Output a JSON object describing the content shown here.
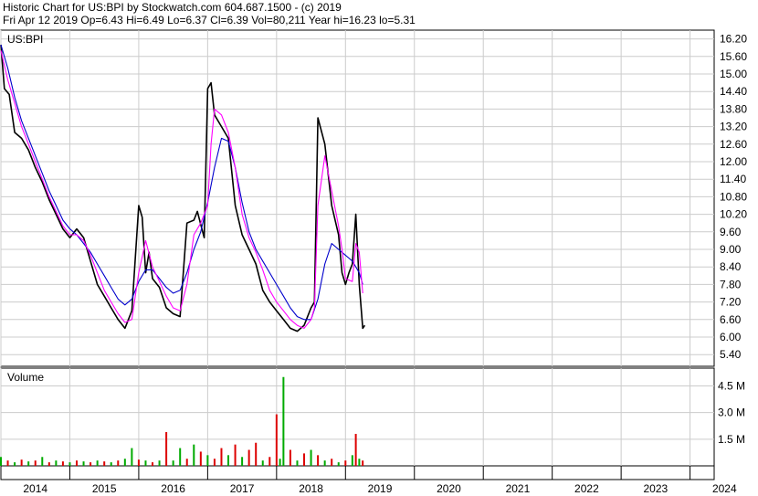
{
  "header": {
    "line1": "Historic Chart for US:BPI by Stockwatch.com 604.687.1500 - (c) 2019",
    "line2": "Fri Apr 12 2019  Op=6.43  Hi=6.49  Lo=6.37  Cl=6.39  Vol=80,211  Year hi=16.23  lo=5.31"
  },
  "colors": {
    "price": "#000000",
    "ma_short": "#ff00ff",
    "ma_long": "#0000cc",
    "vol_up": "#00aa00",
    "vol_down": "#dd0000",
    "grid": "#cccccc"
  },
  "chart_data": {
    "type": "line",
    "symbol_label": "US:BPI",
    "volume_label": "Volume",
    "price_axis": {
      "ylim": [
        5.0,
        16.5
      ],
      "ticks": [
        "16.20",
        "15.60",
        "15.00",
        "14.40",
        "13.80",
        "13.20",
        "12.60",
        "12.00",
        "11.40",
        "10.80",
        "10.20",
        "9.60",
        "9.00",
        "8.40",
        "7.80",
        "7.20",
        "6.60",
        "6.00",
        "5.40"
      ]
    },
    "volume_axis": {
      "ylim": [
        0,
        5500000
      ],
      "ticks": [
        {
          "label": "4.5 M",
          "value": 4500000
        },
        {
          "label": "3.0 M",
          "value": 3000000
        },
        {
          "label": "1.5 M",
          "value": 1500000
        }
      ]
    },
    "x_axis": {
      "xlim": [
        2014.0,
        2024.35
      ],
      "year_labels": [
        "2014",
        "2015",
        "2016",
        "2017",
        "2018",
        "2019",
        "2020",
        "2021",
        "2022",
        "2023",
        "2024"
      ]
    },
    "series": [
      {
        "role": "price",
        "x": [
          2014.0,
          2014.05,
          2014.12,
          2014.2,
          2014.3,
          2014.4,
          2014.5,
          2014.6,
          2014.7,
          2014.8,
          2014.9,
          2015.0,
          2015.1,
          2015.2,
          2015.3,
          2015.4,
          2015.5,
          2015.6,
          2015.7,
          2015.8,
          2015.9,
          2016.0,
          2016.05,
          2016.1,
          2016.15,
          2016.2,
          2016.3,
          2016.4,
          2016.5,
          2016.6,
          2016.7,
          2016.8,
          2016.85,
          2016.95,
          2017.0,
          2017.05,
          2017.1,
          2017.2,
          2017.3,
          2017.4,
          2017.5,
          2017.6,
          2017.7,
          2017.8,
          2017.9,
          2018.0,
          2018.1,
          2018.2,
          2018.3,
          2018.4,
          2018.5,
          2018.55,
          2018.6,
          2018.7,
          2018.8,
          2018.9,
          2018.95,
          2019.0,
          2019.05,
          2019.1,
          2019.15,
          2019.2,
          2019.25,
          2019.28
        ],
        "y": [
          16.0,
          14.5,
          14.3,
          13.0,
          12.8,
          12.4,
          11.8,
          11.3,
          10.7,
          10.2,
          9.7,
          9.4,
          9.7,
          9.4,
          8.6,
          7.8,
          7.4,
          7.0,
          6.6,
          6.3,
          6.9,
          10.5,
          10.1,
          8.2,
          8.9,
          8.0,
          7.7,
          7.0,
          6.8,
          6.7,
          9.9,
          10.0,
          10.3,
          9.4,
          14.5,
          14.7,
          13.6,
          13.2,
          12.8,
          10.5,
          9.5,
          9.0,
          8.5,
          7.6,
          7.2,
          6.9,
          6.6,
          6.3,
          6.2,
          6.4,
          7.0,
          7.2,
          13.5,
          12.6,
          10.5,
          9.5,
          8.2,
          7.8,
          8.2,
          8.5,
          10.2,
          7.8,
          6.3,
          6.4
        ]
      },
      {
        "role": "ma_short",
        "x": [
          2014.0,
          2014.1,
          2014.2,
          2014.3,
          2014.4,
          2014.5,
          2014.6,
          2014.7,
          2014.8,
          2014.9,
          2015.0,
          2015.1,
          2015.2,
          2015.3,
          2015.4,
          2015.5,
          2015.6,
          2015.7,
          2015.8,
          2015.9,
          2016.0,
          2016.1,
          2016.2,
          2016.3,
          2016.4,
          2016.5,
          2016.6,
          2016.7,
          2016.8,
          2016.9,
          2017.0,
          2017.05,
          2017.1,
          2017.2,
          2017.3,
          2017.4,
          2017.5,
          2017.6,
          2017.7,
          2017.8,
          2017.9,
          2018.0,
          2018.1,
          2018.2,
          2018.3,
          2018.4,
          2018.5,
          2018.55,
          2018.6,
          2018.7,
          2018.8,
          2018.9,
          2018.95,
          2019.0,
          2019.1,
          2019.15,
          2019.2,
          2019.25
        ],
        "y": [
          15.8,
          14.8,
          14.0,
          13.2,
          12.6,
          12.0,
          11.4,
          10.8,
          10.3,
          9.8,
          9.5,
          9.5,
          9.3,
          8.8,
          8.2,
          7.6,
          7.2,
          6.8,
          6.5,
          6.6,
          8.2,
          9.3,
          8.4,
          7.9,
          7.4,
          7.0,
          6.9,
          7.8,
          9.5,
          9.9,
          10.5,
          12.6,
          13.8,
          13.6,
          13.0,
          11.8,
          10.2,
          9.4,
          8.9,
          8.3,
          7.6,
          7.2,
          6.9,
          6.6,
          6.4,
          6.3,
          6.6,
          7.0,
          10.5,
          12.2,
          11.0,
          9.8,
          9.0,
          8.0,
          7.9,
          9.2,
          8.9,
          7.5
        ]
      },
      {
        "role": "ma_long",
        "x": [
          2014.0,
          2014.1,
          2014.2,
          2014.3,
          2014.4,
          2014.5,
          2014.6,
          2014.7,
          2014.8,
          2014.9,
          2015.0,
          2015.1,
          2015.2,
          2015.3,
          2015.4,
          2015.5,
          2015.6,
          2015.7,
          2015.8,
          2015.9,
          2016.0,
          2016.1,
          2016.2,
          2016.3,
          2016.4,
          2016.5,
          2016.6,
          2016.7,
          2016.8,
          2016.9,
          2017.0,
          2017.1,
          2017.2,
          2017.3,
          2017.4,
          2017.5,
          2017.6,
          2017.7,
          2017.8,
          2017.9,
          2018.0,
          2018.1,
          2018.2,
          2018.3,
          2018.4,
          2018.5,
          2018.6,
          2018.7,
          2018.8,
          2018.9,
          2019.0,
          2019.1,
          2019.2,
          2019.25
        ],
        "y": [
          16.0,
          15.2,
          14.2,
          13.4,
          12.8,
          12.2,
          11.6,
          11.0,
          10.5,
          10.0,
          9.7,
          9.5,
          9.2,
          8.9,
          8.5,
          8.1,
          7.7,
          7.3,
          7.1,
          7.3,
          7.9,
          8.3,
          8.3,
          8.0,
          7.7,
          7.5,
          7.6,
          8.2,
          9.0,
          9.6,
          10.6,
          11.8,
          12.8,
          12.7,
          11.8,
          10.6,
          9.6,
          9.0,
          8.6,
          8.2,
          7.8,
          7.4,
          7.0,
          6.7,
          6.6,
          6.6,
          7.3,
          8.5,
          9.2,
          9.0,
          8.8,
          8.6,
          8.2,
          7.8
        ]
      }
    ],
    "volume": {
      "x": [
        2014.0,
        2014.1,
        2014.2,
        2014.3,
        2014.4,
        2014.5,
        2014.6,
        2014.7,
        2014.8,
        2014.9,
        2015.0,
        2015.1,
        2015.2,
        2015.3,
        2015.4,
        2015.5,
        2015.6,
        2015.7,
        2015.8,
        2015.9,
        2016.0,
        2016.1,
        2016.2,
        2016.3,
        2016.4,
        2016.5,
        2016.6,
        2016.7,
        2016.8,
        2016.9,
        2017.0,
        2017.1,
        2017.2,
        2017.3,
        2017.4,
        2017.5,
        2017.6,
        2017.7,
        2017.8,
        2017.9,
        2018.0,
        2018.05,
        2018.1,
        2018.2,
        2018.3,
        2018.4,
        2018.5,
        2018.6,
        2018.7,
        2018.8,
        2018.9,
        2019.0,
        2019.1,
        2019.15,
        2019.2,
        2019.25
      ],
      "values": [
        500000,
        300000,
        200000,
        350000,
        250000,
        300000,
        500000,
        200000,
        300000,
        250000,
        200000,
        300000,
        250000,
        200000,
        300000,
        250000,
        200000,
        300000,
        400000,
        1000000,
        350000,
        300000,
        200000,
        300000,
        1900000,
        300000,
        1000000,
        400000,
        1200000,
        800000,
        600000,
        400000,
        1000000,
        600000,
        1200000,
        500000,
        900000,
        1300000,
        300000,
        500000,
        2900000,
        400000,
        5000000,
        900000,
        300000,
        700000,
        900000,
        600000,
        300000,
        400000,
        200000,
        300000,
        600000,
        1800000,
        400000,
        300000
      ],
      "direction": [
        "up",
        "down",
        "up",
        "down",
        "up",
        "down",
        "up",
        "down",
        "up",
        "down",
        "up",
        "down",
        "up",
        "down",
        "up",
        "down",
        "up",
        "down",
        "up",
        "up",
        "down",
        "up",
        "down",
        "up",
        "down",
        "up",
        "up",
        "down",
        "up",
        "down",
        "up",
        "down",
        "down",
        "up",
        "down",
        "up",
        "down",
        "down",
        "up",
        "down",
        "down",
        "up",
        "up",
        "down",
        "up",
        "down",
        "up",
        "down",
        "up",
        "down",
        "up",
        "down",
        "up",
        "down",
        "up",
        "down"
      ]
    }
  }
}
